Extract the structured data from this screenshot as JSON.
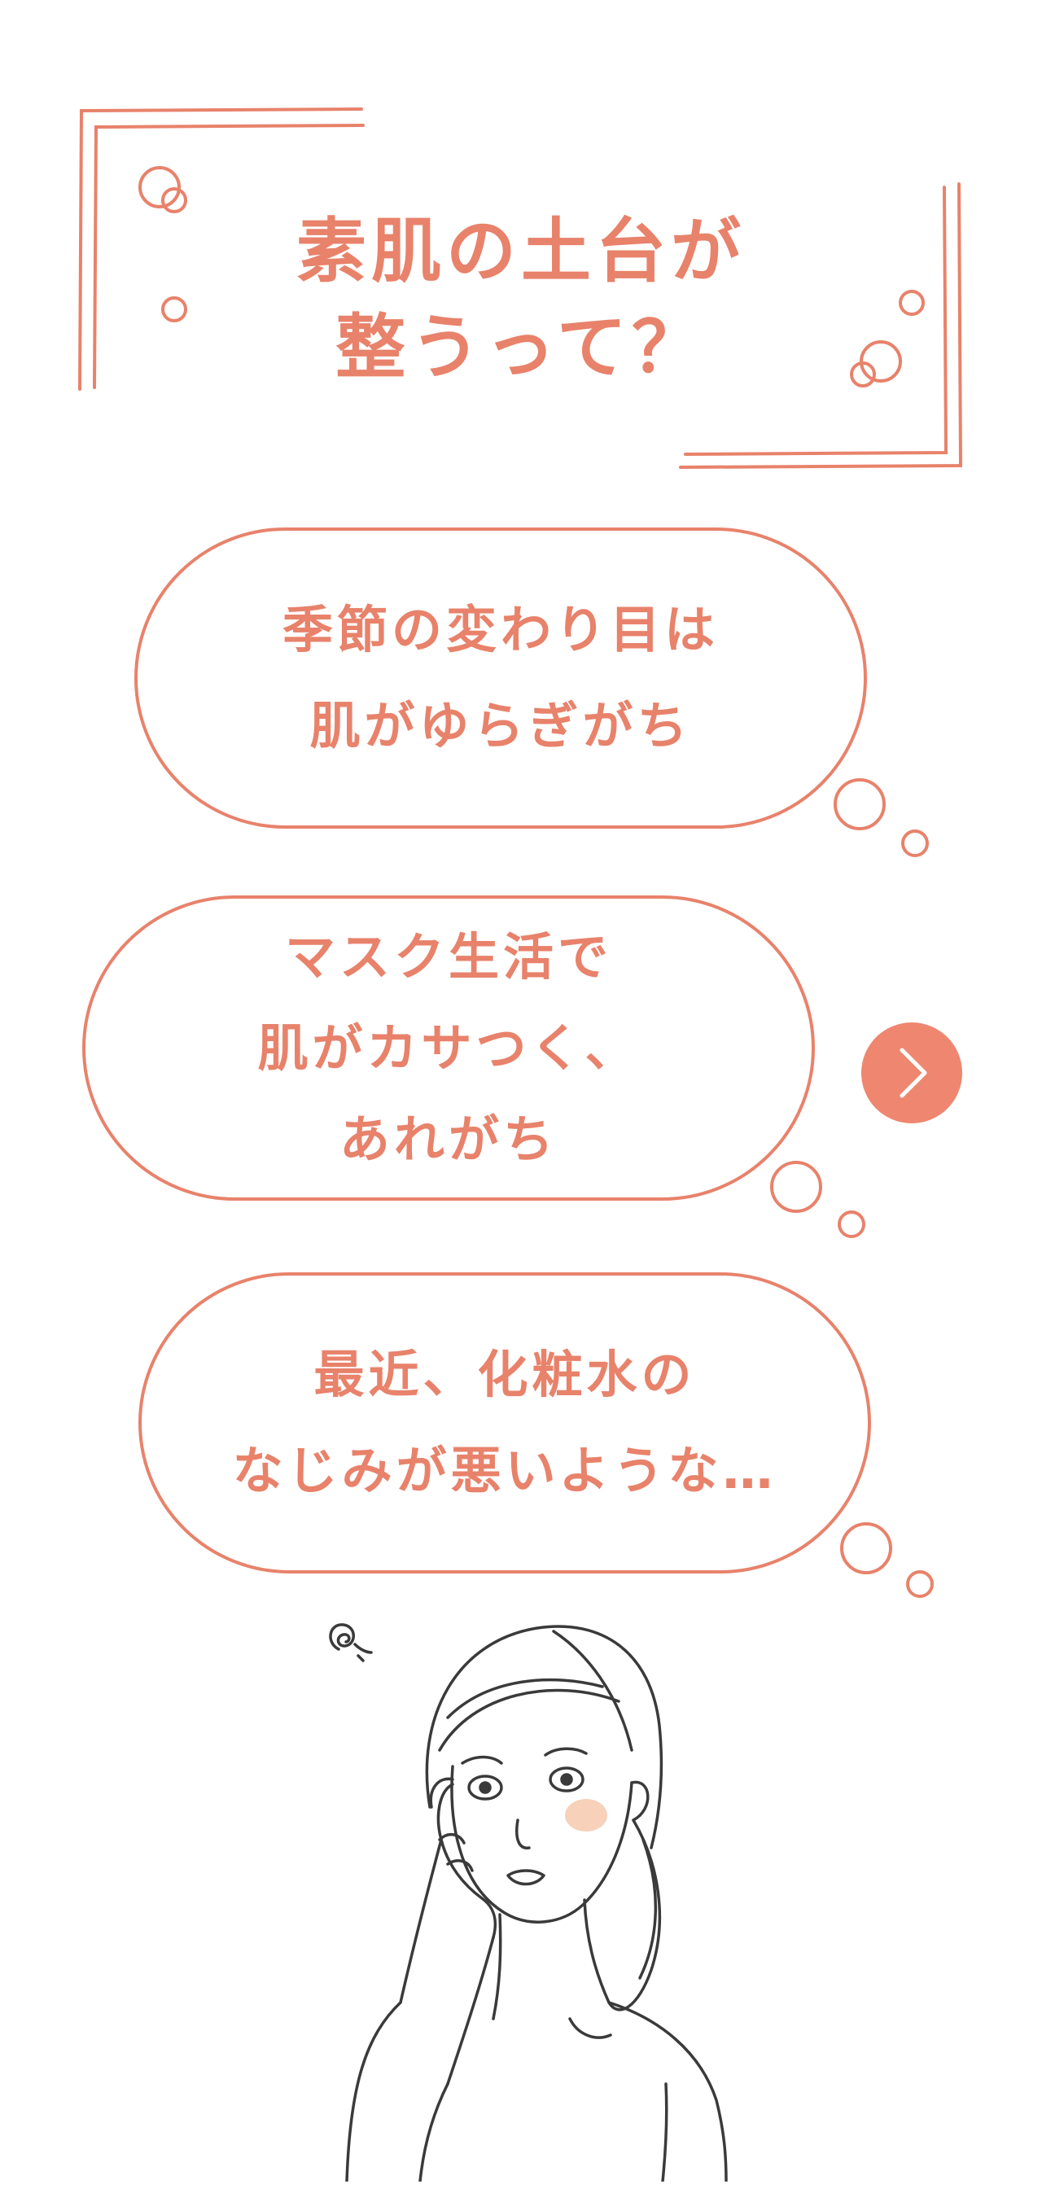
{
  "heading": {
    "line1": "素肌の土台が",
    "line2": "整うって？"
  },
  "bubbles": [
    {
      "lines": [
        "季節の変わり目は",
        "肌がゆらぎがち"
      ]
    },
    {
      "lines": [
        "マスク生活で",
        "肌がカサつく、",
        "あれがち"
      ]
    },
    {
      "lines": [
        "最近、化粧水の",
        "なじみが悪いような…"
      ]
    }
  ],
  "next_button": {
    "icon": "chevron-right-icon"
  },
  "colors": {
    "accent": "#e8826b",
    "button": "#ee8670",
    "line_art": "#3a3a3a",
    "blush": "#f6c9ae",
    "background": "#ffffff"
  }
}
